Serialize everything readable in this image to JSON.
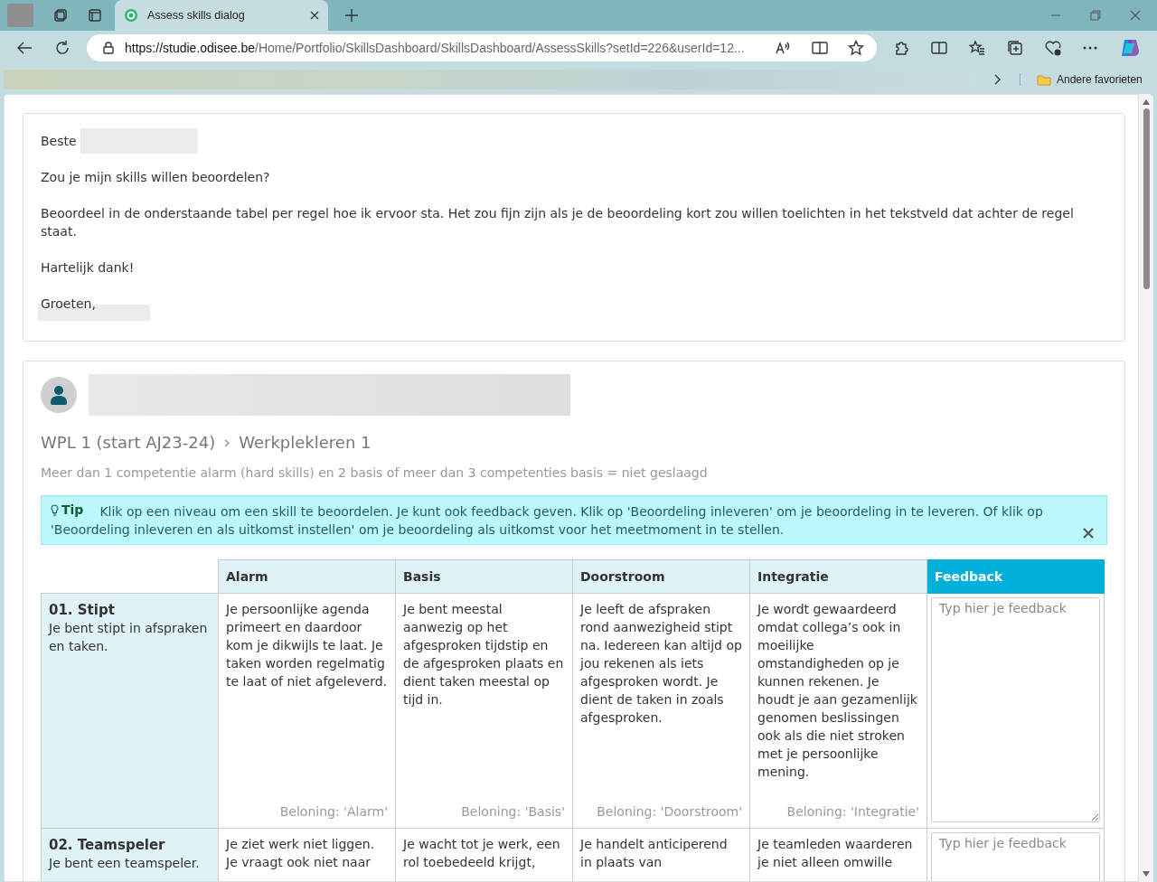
{
  "browser": {
    "tab_title": "Assess skills dialog",
    "url_host": "https://studie.odisee.be",
    "url_path": "/Home/Portfolio/SkillsDashboard/SkillsDashboard/AssessSkills?setId=226&userId=12...",
    "favorites_folder": "Andere favorieten"
  },
  "letter": {
    "greeting": "Beste",
    "lines": [
      "Zou je mijn skills willen beoordelen?",
      "Beoordeel in de onderstaande tabel per regel hoe ik ervoor sta. Het zou fijn zijn als je de beoordeling kort zou willen toelichten in het tekstveld dat achter de regel staat.",
      "Hartelijk dank!"
    ],
    "closing": "Groeten,"
  },
  "assessment": {
    "breadcrumb": [
      "WPL 1 (start AJ23-24)",
      "Werkplekleren 1"
    ],
    "rule": "Meer dan 1 competentie alarm (hard skills) en 2 basis of meer dan 3 competenties basis = niet geslaagd",
    "tip": {
      "label": "Tip",
      "text": "Klik op een niveau om een skill te beoordelen. Je kunt ook feedback geven. Klik op 'Beoordeling inleveren' om je beoordeling in te leveren. Of klik op 'Beoordeling inleveren en als uitkomst instellen' om je beoordeling als uitkomst voor het meetmoment in te stellen."
    },
    "columns": [
      "Alarm",
      "Basis",
      "Doorstroom",
      "Integratie",
      "Feedback"
    ],
    "rows": [
      {
        "title": "01. Stipt",
        "description": "Je bent stipt in afspraken en taken.",
        "levels": [
          {
            "text": "Je persoonlijke agenda primeert en daardoor kom je dikwijls te laat. Je taken worden regelmatig te laat of niet afgeleverd.",
            "reward": "Beloning: 'Alarm'"
          },
          {
            "text": "Je bent meestal aanwezig op het afgesproken tijdstip en de afgesproken plaats en dient taken meestal op tijd in.",
            "reward": "Beloning: 'Basis'"
          },
          {
            "text": "Je leeft de afspraken rond aanwezigheid stipt na. Iedereen kan altijd op jou rekenen als iets afgesproken wordt. Je dient de taken in zoals afgesproken.",
            "reward": "Beloning: 'Doorstroom'"
          },
          {
            "text": "Je wordt gewaardeerd omdat collega’s ook in moeilijke omstandigheden op je kunnen rekenen. Je houdt je aan gezamenlijk genomen beslissingen ook als die niet stroken met je persoonlijke mening.",
            "reward": "Beloning: 'Integratie'"
          }
        ],
        "feedback_placeholder": "Typ hier je feedback"
      },
      {
        "title": "02. Teamspeler",
        "description": "Je bent een teamspeler.",
        "levels": [
          {
            "text": "Je ziet werk niet liggen. Je vraagt ook niet naar"
          },
          {
            "text": "Je wacht tot je werk, een rol toebedeeld krijgt,"
          },
          {
            "text": "Je handelt anticiperend in plaats van"
          },
          {
            "text": "Je teamleden waarderen je niet alleen omwille"
          }
        ],
        "feedback_placeholder": "Typ hier je feedback"
      }
    ]
  }
}
